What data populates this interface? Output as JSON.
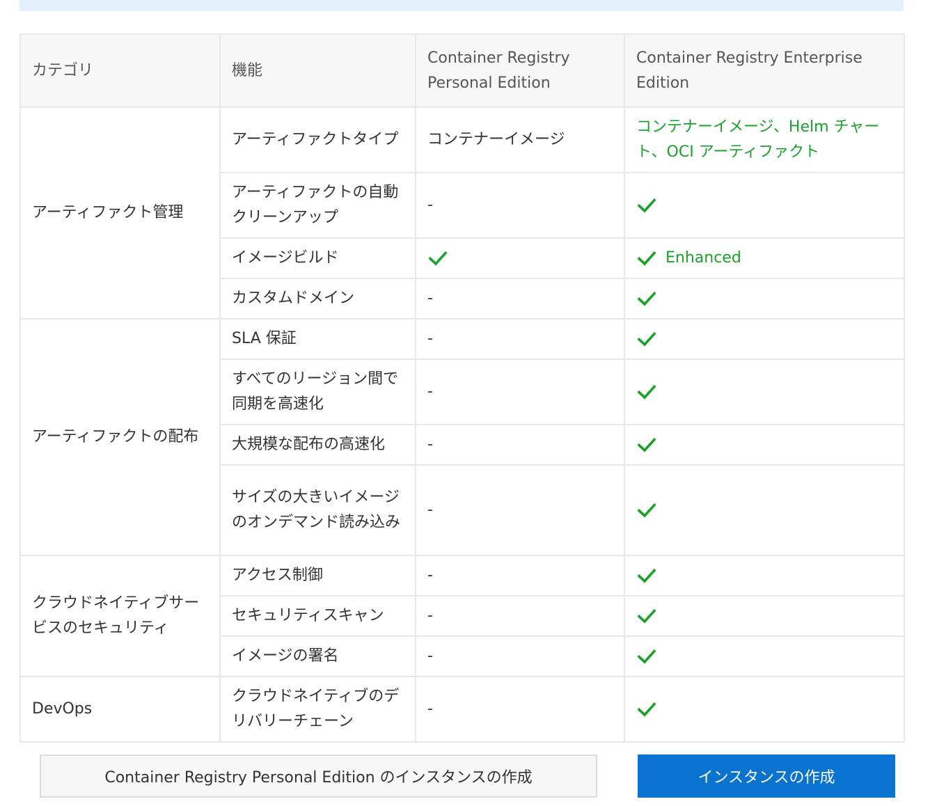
{
  "colors": {
    "check": "#1aa12a",
    "primary_button": "#0a72cf",
    "banner": "#e3f1fc"
  },
  "table": {
    "headers": {
      "category": "カテゴリ",
      "feature": "機能",
      "personal": "Container Registry Personal Edition",
      "enterprise": "Container Registry Enterprise Edition"
    },
    "categories": {
      "artifact_management": "アーティファクト管理",
      "artifact_distribution": "アーティファクトの配布",
      "security": "クラウドネイティブサービスのセキュリティ",
      "devops": "DevOps"
    },
    "rows": [
      {
        "feature": "アーティファクトタイプ",
        "personal": "コンテナーイメージ",
        "enterprise": "コンテナーイメージ、Helm チャート、OCI アーティファクト"
      },
      {
        "feature": "アーティファクトの自動クリーンアップ",
        "personal": "-",
        "enterprise": "check"
      },
      {
        "feature": "イメージビルド",
        "personal": "check",
        "enterprise": "check",
        "enterprise_note": "Enhanced"
      },
      {
        "feature": "カスタムドメイン",
        "personal": "-",
        "enterprise": "check"
      },
      {
        "feature": "SLA 保証",
        "personal": "-",
        "enterprise": "check"
      },
      {
        "feature": "すべてのリージョン間で同期を高速化",
        "personal": "-",
        "enterprise": "check"
      },
      {
        "feature": "大規模な配布の高速化",
        "personal": "-",
        "enterprise": "check"
      },
      {
        "feature": "サイズの大きいイメージのオンデマンド読み込み",
        "personal": "-",
        "enterprise": "check"
      },
      {
        "feature": "アクセス制御",
        "personal": "-",
        "enterprise": "check"
      },
      {
        "feature": "セキュリティスキャン",
        "personal": "-",
        "enterprise": "check"
      },
      {
        "feature": "イメージの署名",
        "personal": "-",
        "enterprise": "check"
      },
      {
        "feature": "クラウドネイティブのデリバリーチェーン",
        "personal": "-",
        "enterprise": "check"
      }
    ]
  },
  "buttons": {
    "create_personal": "Container Registry Personal Edition のインスタンスの作成",
    "create_instance": "インスタンスの作成"
  }
}
